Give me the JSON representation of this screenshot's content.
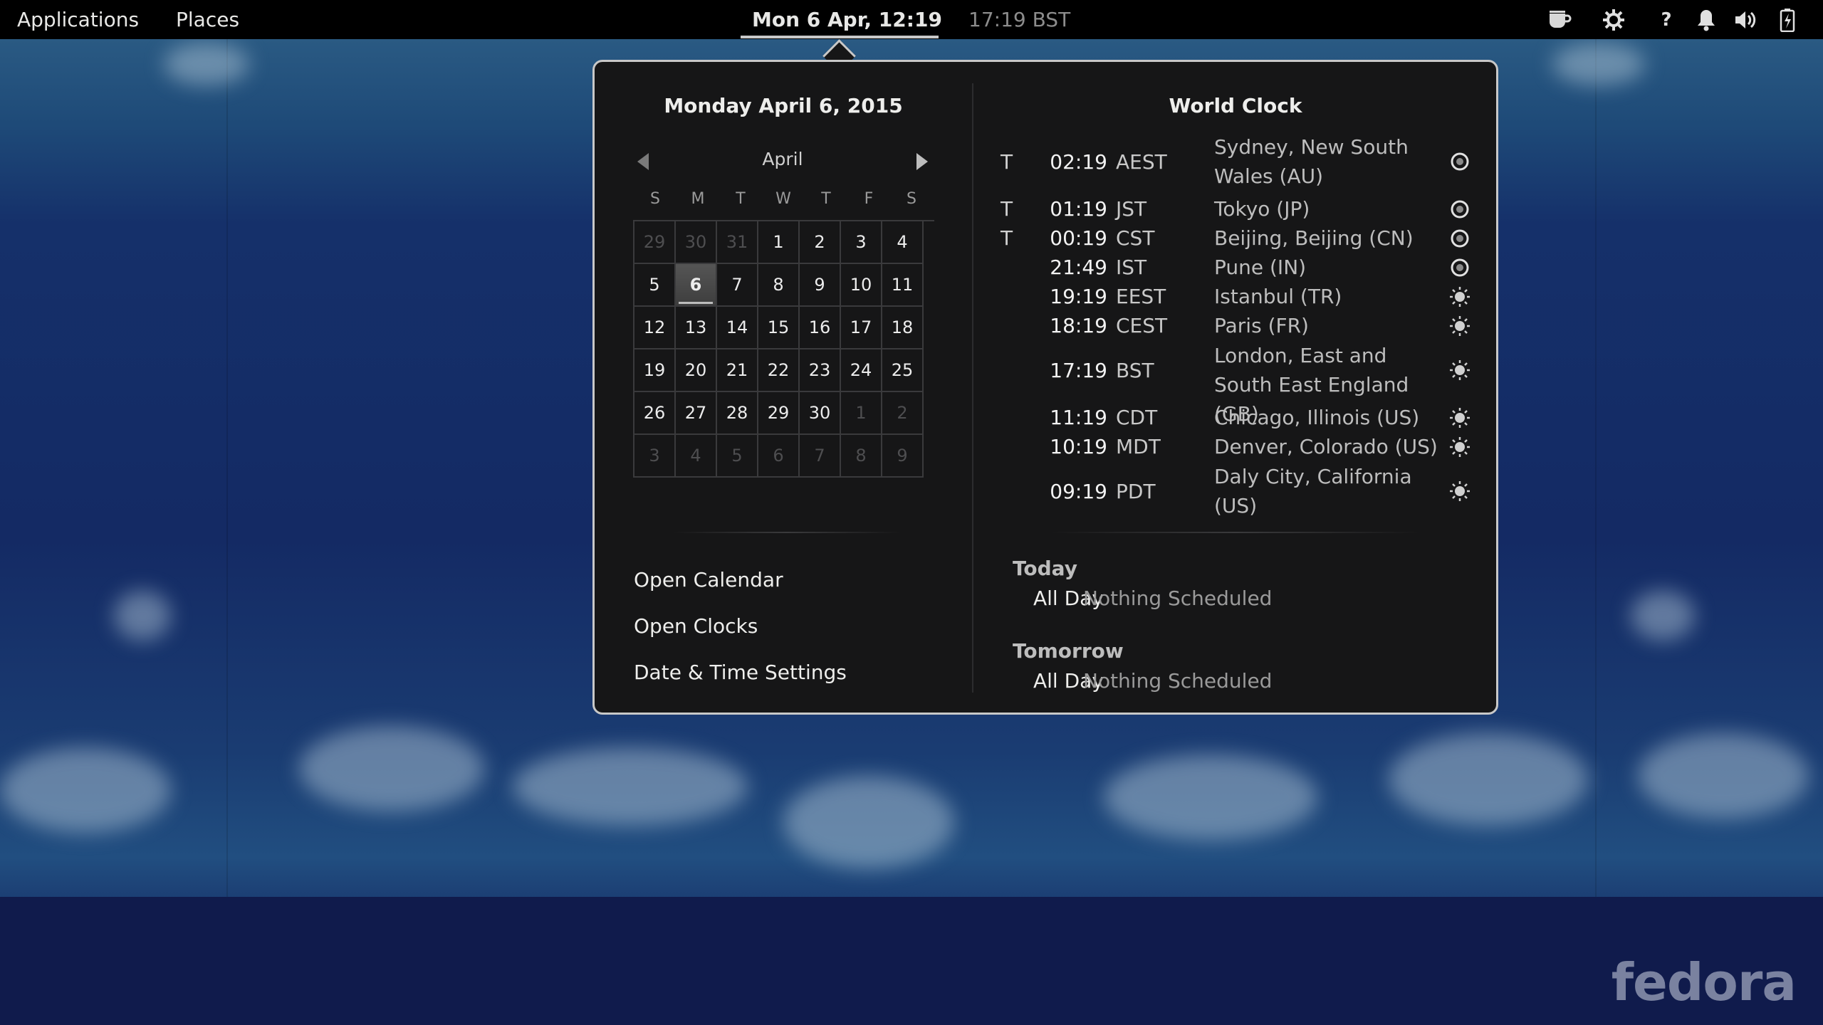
{
  "topbar": {
    "applications": "Applications",
    "places": "Places",
    "clock": "Mon  6 Apr, 12:19",
    "second_clock": "17:19 BST",
    "tray_icons": [
      "coffee-cup-icon",
      "settings-gear-icon",
      "help-icon",
      "notification-bell-icon",
      "volume-icon",
      "battery-icon"
    ],
    "help_glyph": "?"
  },
  "calendar": {
    "date_header": "Monday April  6, 2015",
    "month": "April",
    "weekdays": [
      "S",
      "M",
      "T",
      "W",
      "T",
      "F",
      "S"
    ],
    "weeks": [
      [
        "29",
        "30",
        "31",
        "1",
        "2",
        "3",
        "4"
      ],
      [
        "5",
        "6",
        "7",
        "8",
        "9",
        "10",
        "11"
      ],
      [
        "12",
        "13",
        "14",
        "15",
        "16",
        "17",
        "18"
      ],
      [
        "19",
        "20",
        "21",
        "22",
        "23",
        "24",
        "25"
      ],
      [
        "26",
        "27",
        "28",
        "29",
        "30",
        "1",
        "2"
      ],
      [
        "3",
        "4",
        "5",
        "6",
        "7",
        "8",
        "9"
      ]
    ],
    "today": "6"
  },
  "links": {
    "open_calendar": "Open Calendar",
    "open_clocks": "Open Clocks",
    "datetime_settings": "Date & Time Settings"
  },
  "world_clock": {
    "title": "World Clock",
    "entries": [
      {
        "flag": "T",
        "time": "02:19",
        "zone": "AEST",
        "city": "Sydney, New South Wales (AU)",
        "icon": "moon-icon"
      },
      {
        "flag": "T",
        "time": "01:19",
        "zone": "JST",
        "city": "Tokyo (JP)",
        "icon": "moon-icon"
      },
      {
        "flag": "T",
        "time": "00:19",
        "zone": "CST",
        "city": "Beijing, Beijing (CN)",
        "icon": "moon-icon"
      },
      {
        "flag": "",
        "time": "21:49",
        "zone": "IST",
        "city": "Pune (IN)",
        "icon": "moon-icon"
      },
      {
        "flag": "",
        "time": "19:19",
        "zone": "EEST",
        "city": "Istanbul (TR)",
        "icon": "sun-icon"
      },
      {
        "flag": "",
        "time": "18:19",
        "zone": "CEST",
        "city": "Paris (FR)",
        "icon": "sun-icon"
      },
      {
        "flag": "",
        "time": "17:19",
        "zone": "BST",
        "city": "London, East and South East England (GB)",
        "icon": "sun-icon"
      },
      {
        "flag": "",
        "time": "11:19",
        "zone": "CDT",
        "city": "Chicago, Illinois (US)",
        "icon": "sun-icon"
      },
      {
        "flag": "",
        "time": "10:19",
        "zone": "MDT",
        "city": "Denver, Colorado (US)",
        "icon": "sun-icon"
      },
      {
        "flag": "",
        "time": "09:19",
        "zone": "PDT",
        "city": "Daly City, California (US)",
        "icon": "sun-icon"
      }
    ]
  },
  "events": {
    "today_label": "Today",
    "today_allday": "All Day",
    "today_text": "Nothing Scheduled",
    "tomorrow_label": "Tomorrow",
    "tomorrow_allday": "All Day",
    "tomorrow_text": "Nothing Scheduled"
  },
  "wallpaper": {
    "logo_text": "fedora"
  }
}
